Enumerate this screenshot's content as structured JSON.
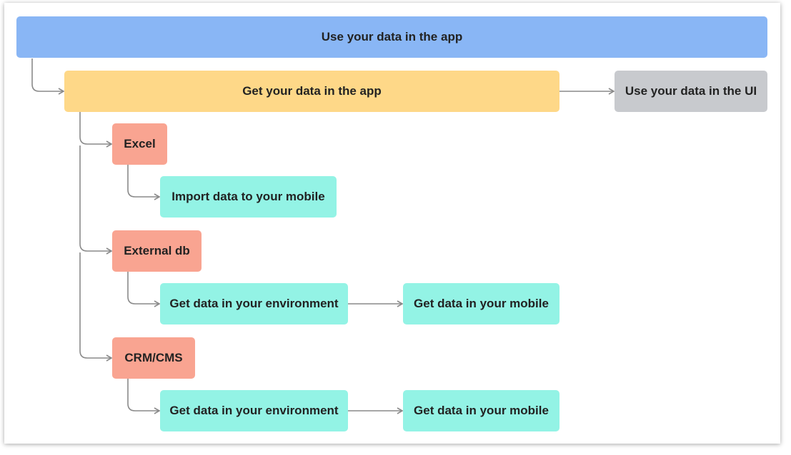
{
  "diagram": {
    "root": {
      "label": "Use your data in the app",
      "color": "#89b6f5"
    },
    "get_data": {
      "label": "Get your data in the app",
      "color": "#fed888"
    },
    "use_ui": {
      "label": "Use your data in the UI",
      "color": "#c8cace"
    },
    "sources": [
      {
        "label": "Excel",
        "color": "#f9a491",
        "steps": [
          {
            "label": "Import data to your mobile",
            "color": "#93f3e5"
          }
        ]
      },
      {
        "label": "External db",
        "color": "#f9a491",
        "steps": [
          {
            "label": "Get data in your environment",
            "color": "#93f3e5"
          },
          {
            "label": "Get data in your mobile",
            "color": "#93f3e5"
          }
        ]
      },
      {
        "label": "CRM/CMS",
        "color": "#f9a491",
        "steps": [
          {
            "label": "Get data in your environment",
            "color": "#93f3e5"
          },
          {
            "label": "Get data in your mobile",
            "color": "#93f3e5"
          }
        ]
      }
    ],
    "connector_color": "#8a8a8a"
  }
}
